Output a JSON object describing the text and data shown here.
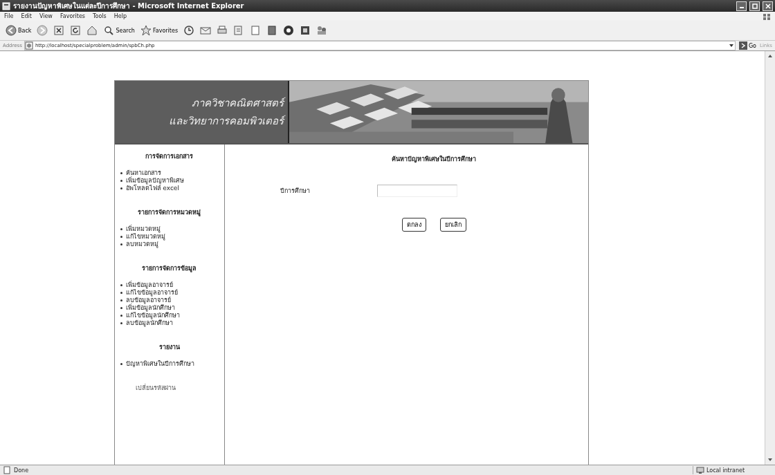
{
  "window": {
    "title": "รายงานปัญหาพิเศษในแต่ละปีการศึกษา - Microsoft Internet Explorer"
  },
  "menu": [
    "File",
    "Edit",
    "View",
    "Favorites",
    "Tools",
    "Help"
  ],
  "toolbar": {
    "back": "Back",
    "search": "Search",
    "favorites": "Favorites"
  },
  "address_bar": {
    "label": "Address",
    "url": "http://localhost/specialproblem/admin/spbCh.php",
    "go": "Go",
    "links": "Links"
  },
  "banner": {
    "lines": [
      "ภาควิชาคณิตศาสตร์",
      "และวิทยาการคอมพิวเตอร์"
    ]
  },
  "sidebar": {
    "sections": [
      {
        "heading": "การจัดการเอกสาร",
        "items": [
          "ค้นหาเอกสาร",
          "เพิ่มข้อมูลปัญหาพิเศษ",
          "อัพโหลดไฟล์ excel"
        ]
      },
      {
        "heading": "รายการจัดการหมวดหมู่",
        "items": [
          "เพิ่มหมวดหมู่",
          "แก้ไขหมวดหมู่",
          "ลบหมวดหมู่"
        ]
      },
      {
        "heading": "รายการจัดการข้อมูล",
        "items": [
          "เพิ่มข้อมูลอาจารย์",
          "แก้ไขข้อมูลอาจารย์",
          "ลบข้อมูลอาจารย์",
          "เพิ่มข้อมูลนักศึกษา",
          "แก้ไขข้อมูลนักศึกษา",
          "ลบข้อมูลนักศึกษา"
        ]
      },
      {
        "heading": "รายงาน",
        "items": [
          "ปัญหาพิเศษในปีการศึกษา"
        ]
      }
    ],
    "footer_link": "เปลี่ยนรหัสผ่าน"
  },
  "main": {
    "title": "ค้นหาปัญหาพิเศษในปีการศึกษา",
    "field_label": "ปีการศึกษา",
    "buttons": [
      "ตกลง",
      "ยกเลิก"
    ]
  },
  "status_bar": {
    "text": "Done",
    "zone": "Local intranet"
  }
}
